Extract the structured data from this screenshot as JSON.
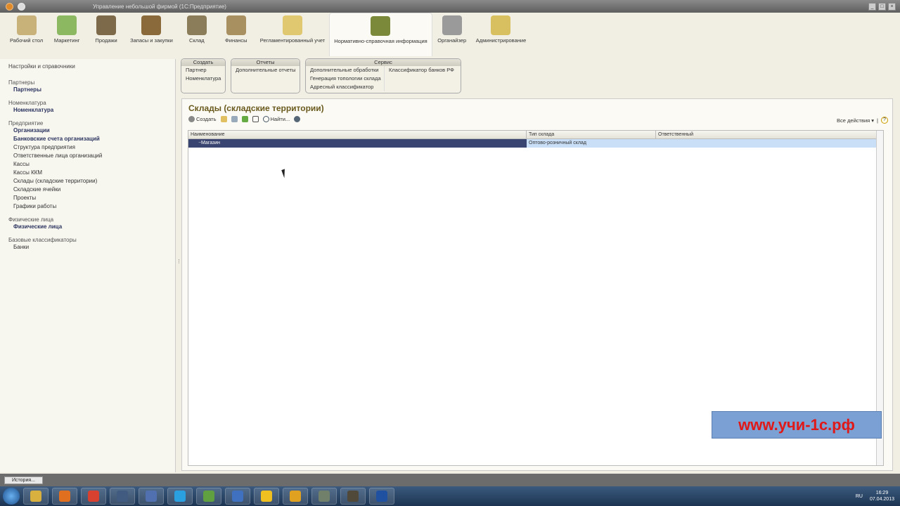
{
  "titlebar": {
    "title": "Управление небольшой фирмой (1С:Предприятие)"
  },
  "sections": [
    {
      "label": "Рабочий стол",
      "color": "#c8b27a"
    },
    {
      "label": "Маркетинг",
      "color": "#8bb860"
    },
    {
      "label": "Продажи",
      "color": "#7d6a4a"
    },
    {
      "label": "Запасы и закупки",
      "color": "#8a6a3a"
    },
    {
      "label": "Склад",
      "color": "#8b7d5a"
    },
    {
      "label": "Финансы",
      "color": "#a89060"
    },
    {
      "label": "Регламентированный учет",
      "color": "#e0c870"
    },
    {
      "label": "Нормативно-справочная информация",
      "color": "#7a8a3a"
    },
    {
      "label": "Органайзер",
      "color": "#9a9a9a"
    },
    {
      "label": "Администрирование",
      "color": "#d8c060"
    }
  ],
  "left": {
    "header": "Настройки и справочники",
    "groups": [
      {
        "title": "Партнеры",
        "items": [
          {
            "label": "Партнеры",
            "bold": true
          }
        ]
      },
      {
        "title": "Номенклатура",
        "items": [
          {
            "label": "Номенклатура",
            "bold": true
          }
        ]
      },
      {
        "title": "Предприятие",
        "items": [
          {
            "label": "Организации",
            "bold": true
          },
          {
            "label": "Банковские счета организаций",
            "bold": true
          },
          {
            "label": "Структура предприятия"
          },
          {
            "label": "Ответственные лица организаций"
          },
          {
            "label": "Кассы"
          },
          {
            "label": "Кассы ККМ"
          },
          {
            "label": "Склады (складские территории)"
          },
          {
            "label": "Складские ячейки"
          },
          {
            "label": "Проекты"
          },
          {
            "label": "Графики работы"
          }
        ]
      },
      {
        "title": "Физические лица",
        "items": [
          {
            "label": "Физические лица",
            "bold": true
          }
        ]
      },
      {
        "title": "Базовые классификаторы",
        "items": [
          {
            "label": "Банки"
          }
        ]
      }
    ]
  },
  "commands": {
    "create": {
      "title": "Создать",
      "items": [
        "Партнер",
        "Номенклатура"
      ]
    },
    "reports": {
      "title": "Отчеты",
      "items": [
        "Дополнительные отчеты"
      ]
    },
    "service": {
      "title": "Сервис",
      "col1": [
        "Дополнительные обработки",
        "Генерация топологии склада",
        "Адресный классификатор"
      ],
      "col2": [
        "Классификатор банков РФ"
      ]
    }
  },
  "main": {
    "title": "Склады (складские территории)",
    "toolbar": {
      "create": "Создать",
      "find": "Найти..."
    },
    "all_actions": "Все действия ▾",
    "help": "?",
    "columns": [
      "Наименование",
      "Тип склада",
      "Ответственный"
    ],
    "rows": [
      {
        "name": "Магазин",
        "type": "Оптово-розничный склад",
        "responsible": ""
      }
    ]
  },
  "watermark": "www.учи-1с.рф",
  "status": {
    "history": "История..."
  },
  "taskbar": {
    "lang": "RU",
    "time": "16:29",
    "date": "07.04.2013",
    "apps": [
      "#d8b040",
      "#e07020",
      "#d84030",
      "#405a80",
      "#5070b0",
      "#2aa0e0",
      "#60a040",
      "#4070c0",
      "#f0c020",
      "#e0a020",
      "#70806a",
      "#504838",
      "#2050a0"
    ]
  }
}
